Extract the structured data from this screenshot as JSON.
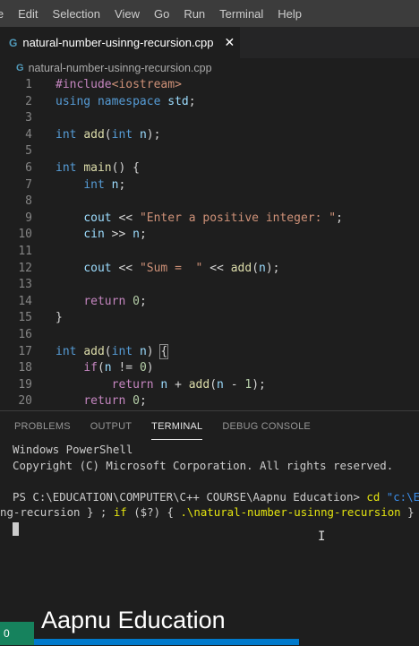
{
  "menubar": {
    "items": [
      "le",
      "Edit",
      "Selection",
      "View",
      "Go",
      "Run",
      "Terminal",
      "Help"
    ]
  },
  "tab": {
    "icon": "G",
    "filename": "natural-number-usinng-recursion.cpp",
    "close_glyph": "✕"
  },
  "breadcrumb": {
    "icon": "G",
    "filename": "natural-number-usinng-recursion.cpp"
  },
  "editor": {
    "line_numbers": [
      "1",
      "2",
      "3",
      "4",
      "5",
      "6",
      "7",
      "8",
      "9",
      "10",
      "11",
      "12",
      "13",
      "14",
      "15",
      "16",
      "17",
      "18",
      "19",
      "20"
    ]
  },
  "panel": {
    "tabs": [
      "PROBLEMS",
      "OUTPUT",
      "TERMINAL",
      "DEBUG CONSOLE"
    ],
    "active_tab": "TERMINAL"
  },
  "terminal": {
    "line1": "Windows PowerShell",
    "line2": "Copyright (C) Microsoft Corporation. All rights reserved.",
    "prompt": "PS C:\\EDUCATION\\COMPUTER\\C++ COURSE\\Aapnu Education> ",
    "cmd": "cd",
    "path_arg": " \"c:\\EDUCATION\\COMPUTER\\C++ COURSE\\Aapnu Education\\\"",
    "line4a": "ng-recursion } ; ",
    "line4_if": "if",
    "line4b": " ($?) { ",
    "line4_run": ".\\natural-number-usinng-recursion",
    "line4c": " }"
  },
  "status": {
    "left_text": "0"
  },
  "watermark": "Aapnu Education",
  "colors": {
    "accent": "#007acc",
    "remote": "#16825d",
    "background": "#1e1e1e"
  }
}
